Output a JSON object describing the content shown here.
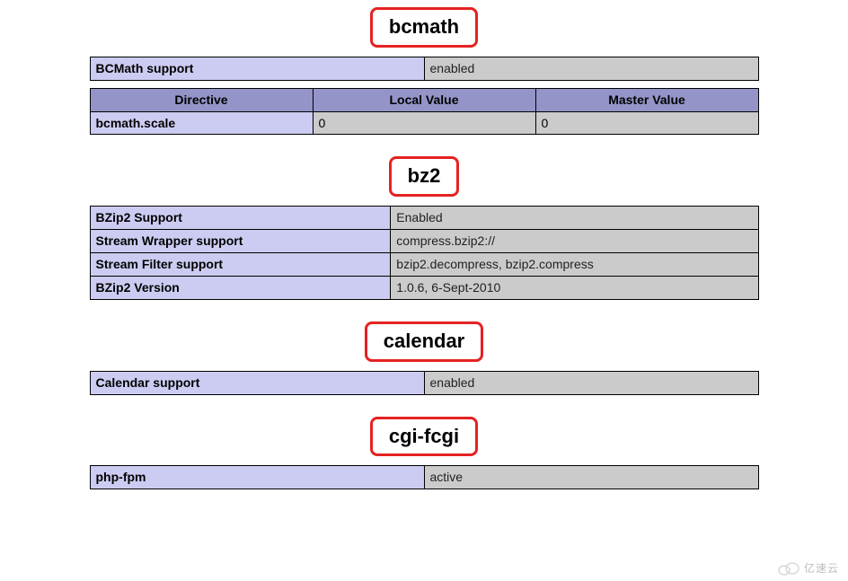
{
  "sections": {
    "bcmath": {
      "title": "bcmath",
      "support": {
        "label": "BCMath support",
        "value": "enabled"
      },
      "dir_headers": [
        "Directive",
        "Local Value",
        "Master Value"
      ],
      "directives": [
        {
          "name": "bcmath.scale",
          "local": "0",
          "master": "0"
        }
      ]
    },
    "bz2": {
      "title": "bz2",
      "rows": [
        {
          "label": "BZip2 Support",
          "value": "Enabled"
        },
        {
          "label": "Stream Wrapper support",
          "value": "compress.bzip2://"
        },
        {
          "label": "Stream Filter support",
          "value": "bzip2.decompress, bzip2.compress"
        },
        {
          "label": "BZip2 Version",
          "value": "1.0.6, 6-Sept-2010"
        }
      ]
    },
    "calendar": {
      "title": "calendar",
      "support": {
        "label": "Calendar support",
        "value": "enabled"
      }
    },
    "cgi": {
      "title": "cgi-fcgi",
      "support": {
        "label": "php-fpm",
        "value": "active"
      }
    }
  },
  "watermark": "亿速云"
}
